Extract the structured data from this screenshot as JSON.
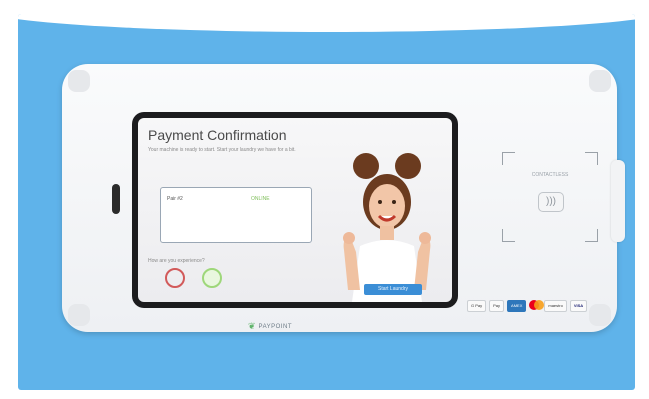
{
  "screen": {
    "title": "Payment Confirmation",
    "subtitle": "Your machine is ready to start. Start your laundry we have for a bit.",
    "card": {
      "label": "Pair #2",
      "value": "ONLINE"
    },
    "question": "How are you experience?",
    "cta_label": "Start Laundry"
  },
  "reader": {
    "label": "CONTACTLESS",
    "icon": "contactless-icon"
  },
  "payments": [
    "G Pay",
    "Pay",
    "AMEX",
    "mastercard",
    "maestro",
    "VISA"
  ],
  "brand": {
    "name": "PAYPOINT",
    "icon": "brand-leaf-icon"
  },
  "colors": {
    "background": "#5fb3ea",
    "accent": "#3b8ed6",
    "negative": "#d25a5a",
    "positive": "#9ed77a"
  }
}
